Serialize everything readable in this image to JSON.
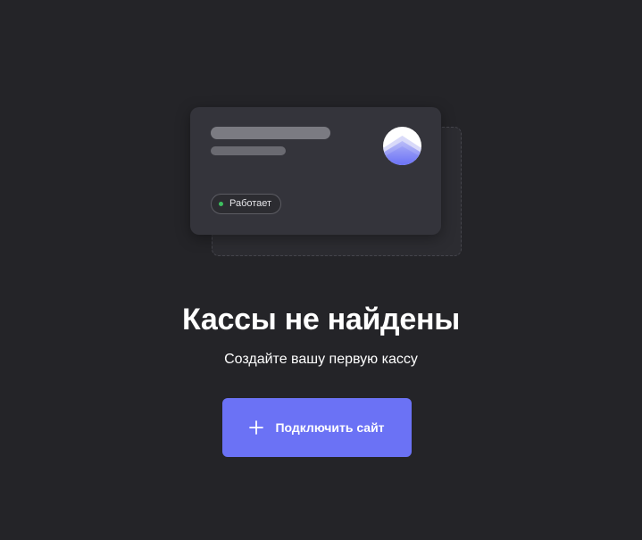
{
  "colors": {
    "background": "#242428",
    "card": "#34343b",
    "accent": "#6b72f5",
    "status_ok": "#3dbf5f"
  },
  "illustration": {
    "status_label": "Работает",
    "logo_icon": "stacked-chevron-logo-icon"
  },
  "empty_state": {
    "title": "Кассы не найдены",
    "subtitle": "Создайте вашу первую кассу"
  },
  "primary_action": {
    "icon": "plus-icon",
    "label": "Подключить сайт"
  }
}
